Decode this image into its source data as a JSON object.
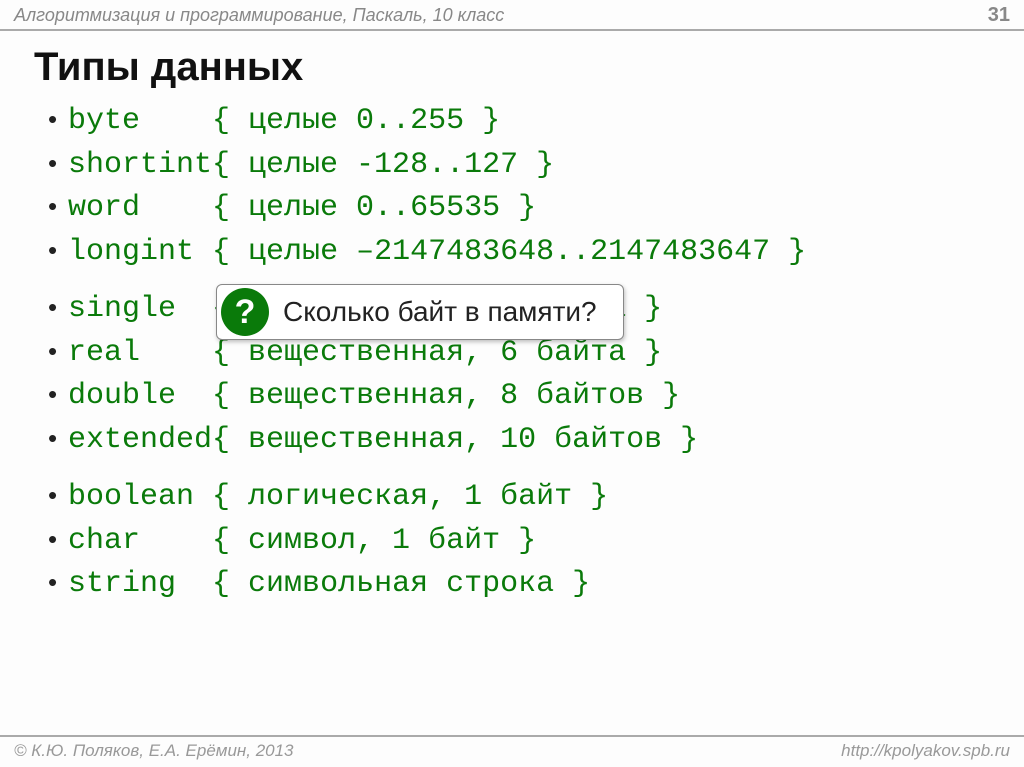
{
  "header": {
    "subject": "Алгоритмизация и программирование, Паскаль, 10 класс",
    "page": "31"
  },
  "title": "Типы данных",
  "types": [
    {
      "name": "byte",
      "pad": "    ",
      "comment": "{ целые 0..255 }"
    },
    {
      "name": "shortint",
      "pad": "",
      "comment": "{ целые -128..127 }"
    },
    {
      "name": "word",
      "pad": "    ",
      "comment": "{ целые 0..65535 }"
    },
    {
      "name": "longint",
      "pad": " ",
      "comment": "{ целые –2147483648..2147483647 }"
    }
  ],
  "types2": [
    {
      "name": "single",
      "pad": "  ",
      "comment": "{ вещественная, 4 байта }"
    },
    {
      "name": "real",
      "pad": "    ",
      "comment": "{ вещественная, 6 байта }"
    },
    {
      "name": "double",
      "pad": "  ",
      "comment": "{ вещественная, 8 байтов }"
    },
    {
      "name": "extended",
      "pad": "",
      "comment": "{ вещественная, 10 байтов }"
    }
  ],
  "types3": [
    {
      "name": "boolean",
      "pad": " ",
      "comment": "{ логическая, 1 байт }"
    },
    {
      "name": "char",
      "pad": "    ",
      "comment": "{ символ, 1 байт }"
    },
    {
      "name": "string",
      "pad": "  ",
      "comment": "{ символьная строка }"
    }
  ],
  "callout": {
    "icon": "?",
    "text": "Сколько байт в памяти?"
  },
  "footer": {
    "left": "© К.Ю. Поляков, Е.А. Ерёмин, 2013",
    "right": "http://kpolyakov.spb.ru"
  }
}
